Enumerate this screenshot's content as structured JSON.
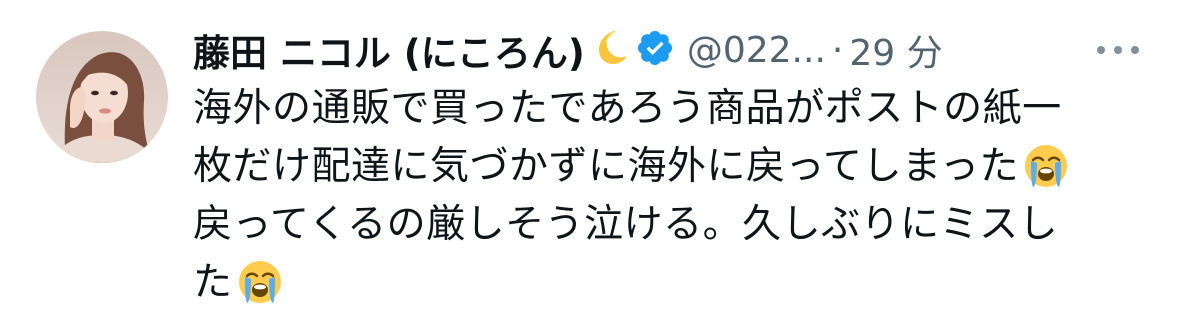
{
  "tweet": {
    "display_name": "藤田 ニコル (にころん)",
    "name_emoji": "crescent-moon-icon",
    "verified_badge": "verified-badge-icon",
    "handle": "@022...",
    "separator": "·",
    "timestamp": "29 分",
    "more_icon": "more-options-icon",
    "text_lines": [
      "海外の通販で買ったであろう商品がポストの紙一",
      "枚だけ配達に気づかずに海外に戻ってしまった",
      "戻ってくるの厳しそう泣ける。久しぶりにミスし",
      "た"
    ],
    "text_emoji": "loudly-crying-face-icon",
    "colors": {
      "text": "#0f1419",
      "secondary": "#536471",
      "verified": "#1d9bf0"
    }
  }
}
